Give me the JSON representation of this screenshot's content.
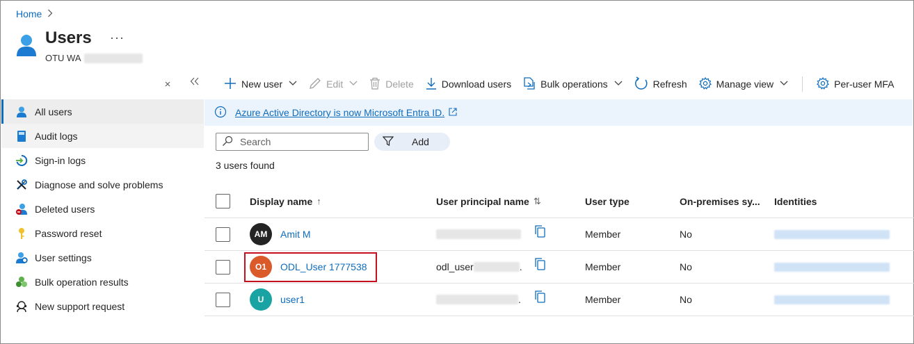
{
  "breadcrumb": {
    "home": "Home"
  },
  "page": {
    "title": "Users",
    "more": "···",
    "subtitle": "OTU WA"
  },
  "sidebar": {
    "items": [
      {
        "label": "All users",
        "icon": "user-icon"
      },
      {
        "label": "Audit logs",
        "icon": "book-icon"
      },
      {
        "label": "Sign-in logs",
        "icon": "sign-in-icon"
      },
      {
        "label": "Diagnose and solve problems",
        "icon": "wrench-icon"
      },
      {
        "label": "Deleted users",
        "icon": "deleted-user-icon"
      },
      {
        "label": "Password reset",
        "icon": "key-icon"
      },
      {
        "label": "User settings",
        "icon": "user-settings-icon"
      },
      {
        "label": "Bulk operation results",
        "icon": "bulk-results-icon"
      },
      {
        "label": "New support request",
        "icon": "support-icon"
      }
    ]
  },
  "toolbar": {
    "new_user": "New user",
    "edit": "Edit",
    "delete": "Delete",
    "download": "Download users",
    "bulk": "Bulk operations",
    "refresh": "Refresh",
    "manage_view": "Manage view",
    "per_user_mfa": "Per-user MFA"
  },
  "banner": {
    "text": "Azure Active Directory is now Microsoft Entra ID."
  },
  "search": {
    "placeholder": "Search",
    "add_filter": "Add"
  },
  "results": {
    "count": "3 users found"
  },
  "table": {
    "headers": {
      "display_name": "Display name",
      "display_name_sort": "↑",
      "upn": "User principal name",
      "upn_sort": "⇅",
      "user_type": "User type",
      "on_prem": "On-premises sy...",
      "identities": "Identities"
    },
    "rows": [
      {
        "initials": "AM",
        "avatar_color": "#242424",
        "name": "Amit M",
        "upn": "",
        "user_type": "Member",
        "on_prem": "No"
      },
      {
        "initials": "O1",
        "avatar_color": "#da5a2a",
        "name": "ODL_User 1777538",
        "upn": "odl_user",
        "upn_tail": ".",
        "user_type": "Member",
        "on_prem": "No"
      },
      {
        "initials": "U",
        "avatar_color": "#1aa3a3",
        "name": "user1",
        "upn": "",
        "upn_tail": ".",
        "user_type": "Member",
        "on_prem": "No"
      }
    ]
  },
  "colors": {
    "accent": "#0f6cbd",
    "highlight": "#c50f1f",
    "banner_bg": "#ebf3fc"
  }
}
